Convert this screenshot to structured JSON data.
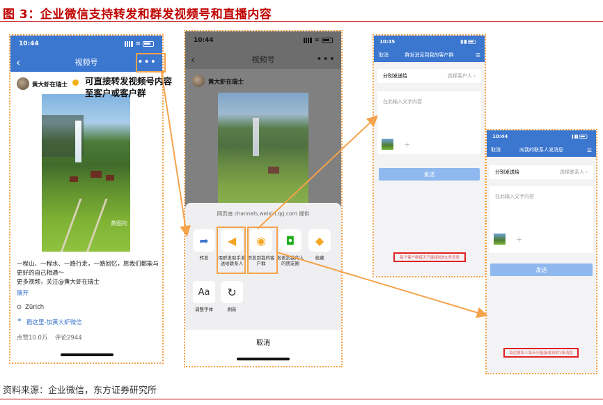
{
  "figure": {
    "title": "图 3：企业微信支持转发和群发视频号和直播内容",
    "source": "资料来源：企业微信，东方证券研究所",
    "annotation": "可直接转发视频号内容\n至客户或客户群"
  },
  "phone1": {
    "time": "10:44",
    "nav_title": "视频号",
    "back_icon": "chevron-left-icon",
    "more_icon": "more-dots-icon",
    "author": "黄大虾在瑞士",
    "photo_watermark": "黄图的",
    "caption": "一程山、一程水、一路行走，一路回忆，愿我们都能与更好的自己相遇～\n更多视频，关注@黄大虾在瑞士",
    "expand": "展开",
    "location": "Zürich",
    "link": "戳这里-加黄大虾微信",
    "likes": "点赞10.0万",
    "comments": "评论2944"
  },
  "phone2": {
    "time": "10:44",
    "nav_title": "视频号",
    "author": "黄大虾在瑞士",
    "provider": "网页由 channels.weixin.qq.com 提供",
    "actions": [
      {
        "label": "转发",
        "icon": "forward-arrow-icon"
      },
      {
        "label": "用群发助手发送给联系人",
        "icon": "megaphone-icon"
      },
      {
        "label": "群发到我的客户群",
        "icon": "rss-icon"
      },
      {
        "label": "发表到我的人的朋友圈",
        "icon": "camera-icon"
      },
      {
        "label": "收藏",
        "icon": "cube-icon"
      }
    ],
    "actions2": [
      {
        "label": "调整字体",
        "icon": "font-aa-icon"
      },
      {
        "label": "刷新",
        "icon": "refresh-icon"
      }
    ],
    "cancel": "取消"
  },
  "phone3": {
    "time": "10:45",
    "cancel": "取消",
    "nav_title": "群发消息到我的客户群",
    "to_label": "分别发送给",
    "to_value": "选择客户人 ›",
    "placeholder": "在此输入文字内容",
    "send": "发送",
    "limit_note": "每个客户群每天只能接收的1条消息"
  },
  "phone4": {
    "time": "10:44",
    "cancel": "取消",
    "nav_title": "向我的联系人发消息",
    "to_label": "分别发送给",
    "to_value": "选择联系人 ›",
    "placeholder": "在此输入文字内容",
    "send": "发送",
    "limit_note": "每位联系人每天只能接收到的1条消息"
  },
  "colors": {
    "accent_red": "#c00000",
    "orange": "#f5a24a",
    "wecom_blue": "#3b76cf",
    "send_blue": "#8fb8ee",
    "note_red": "#e02020"
  }
}
